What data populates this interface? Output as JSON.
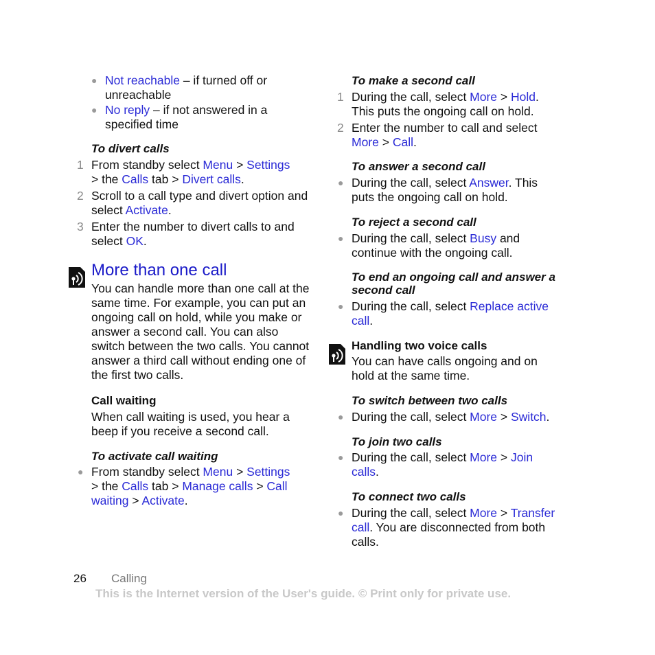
{
  "left_column": {
    "bullets_top": [
      {
        "link": "Not reachable",
        "text": " – if turned off or unreachable"
      },
      {
        "link": "No reply",
        "text": " – if not answered in a specified time"
      }
    ],
    "divert_heading": "To divert calls",
    "divert_steps": [
      {
        "num": "1",
        "parts": [
          "From standby select ",
          "Menu",
          " > ",
          "Settings",
          " > the ",
          "Calls",
          " tab > ",
          "Divert calls",
          "."
        ]
      },
      {
        "num": "2",
        "parts": [
          "Scroll to a call type and divert option and select ",
          "Activate",
          "."
        ]
      },
      {
        "num": "3",
        "parts": [
          "Enter the number to divert calls to and select ",
          "OK",
          "."
        ]
      }
    ],
    "section_title": "More than one call",
    "section_icon": "phone-signal-icon",
    "section_body": "You can handle more than one call at the same time. For example, you can put an ongoing call on hold, while you make or answer a second call. You can also switch between the two calls. You cannot answer a third call without ending one of the first two calls.",
    "call_waiting_heading": "Call waiting",
    "call_waiting_body": "When call waiting is used, you hear a beep if you receive a second call.",
    "activate_heading": "To activate call waiting",
    "activate_parts": [
      "From standby select ",
      "Menu",
      " > ",
      "Settings",
      " > the ",
      "Calls",
      " tab > ",
      "Manage calls",
      " > ",
      "Call waiting",
      " > ",
      "Activate",
      "."
    ]
  },
  "right_column": {
    "make_heading": "To make a second call",
    "make_steps": [
      {
        "num": "1",
        "parts": [
          "During the call, select ",
          "More",
          " > ",
          "Hold",
          ". This puts the ongoing call on hold."
        ]
      },
      {
        "num": "2",
        "parts": [
          "Enter the number to call and select ",
          "More",
          " > ",
          "Call",
          "."
        ]
      }
    ],
    "answer_heading": "To answer a second call",
    "answer_parts": [
      "During the call, select ",
      "Answer",
      ". This puts the ongoing call on hold."
    ],
    "reject_heading": "To reject a second call",
    "reject_parts": [
      "During the call, select ",
      "Busy",
      " and continue with the ongoing call."
    ],
    "end_heading": "To end an ongoing call and answer a second call",
    "end_parts": [
      "During the call, select ",
      "Replace active call",
      "."
    ],
    "handling_heading": "Handling two voice calls",
    "handling_icon": "phone-signal-icon",
    "handling_body": "You can have calls ongoing and on hold at the same time.",
    "switch_heading": "To switch between two calls",
    "switch_parts": [
      "During the call, select ",
      "More",
      " > ",
      "Switch",
      "."
    ],
    "join_heading": "To join two calls",
    "join_parts": [
      "During the call, select ",
      "More",
      " > ",
      "Join calls",
      "."
    ],
    "connect_heading": "To connect two calls",
    "connect_parts": [
      "During the call, select ",
      "More",
      " > ",
      "Transfer call",
      ". You are disconnected from both calls."
    ]
  },
  "footer": {
    "page_number": "26",
    "section": "Calling",
    "note": "This is the Internet version of the User's guide. © Print only for private use."
  },
  "colors": {
    "link": "#2a2ad6",
    "title": "#1a1ac8",
    "note": "#c8c8c8"
  }
}
